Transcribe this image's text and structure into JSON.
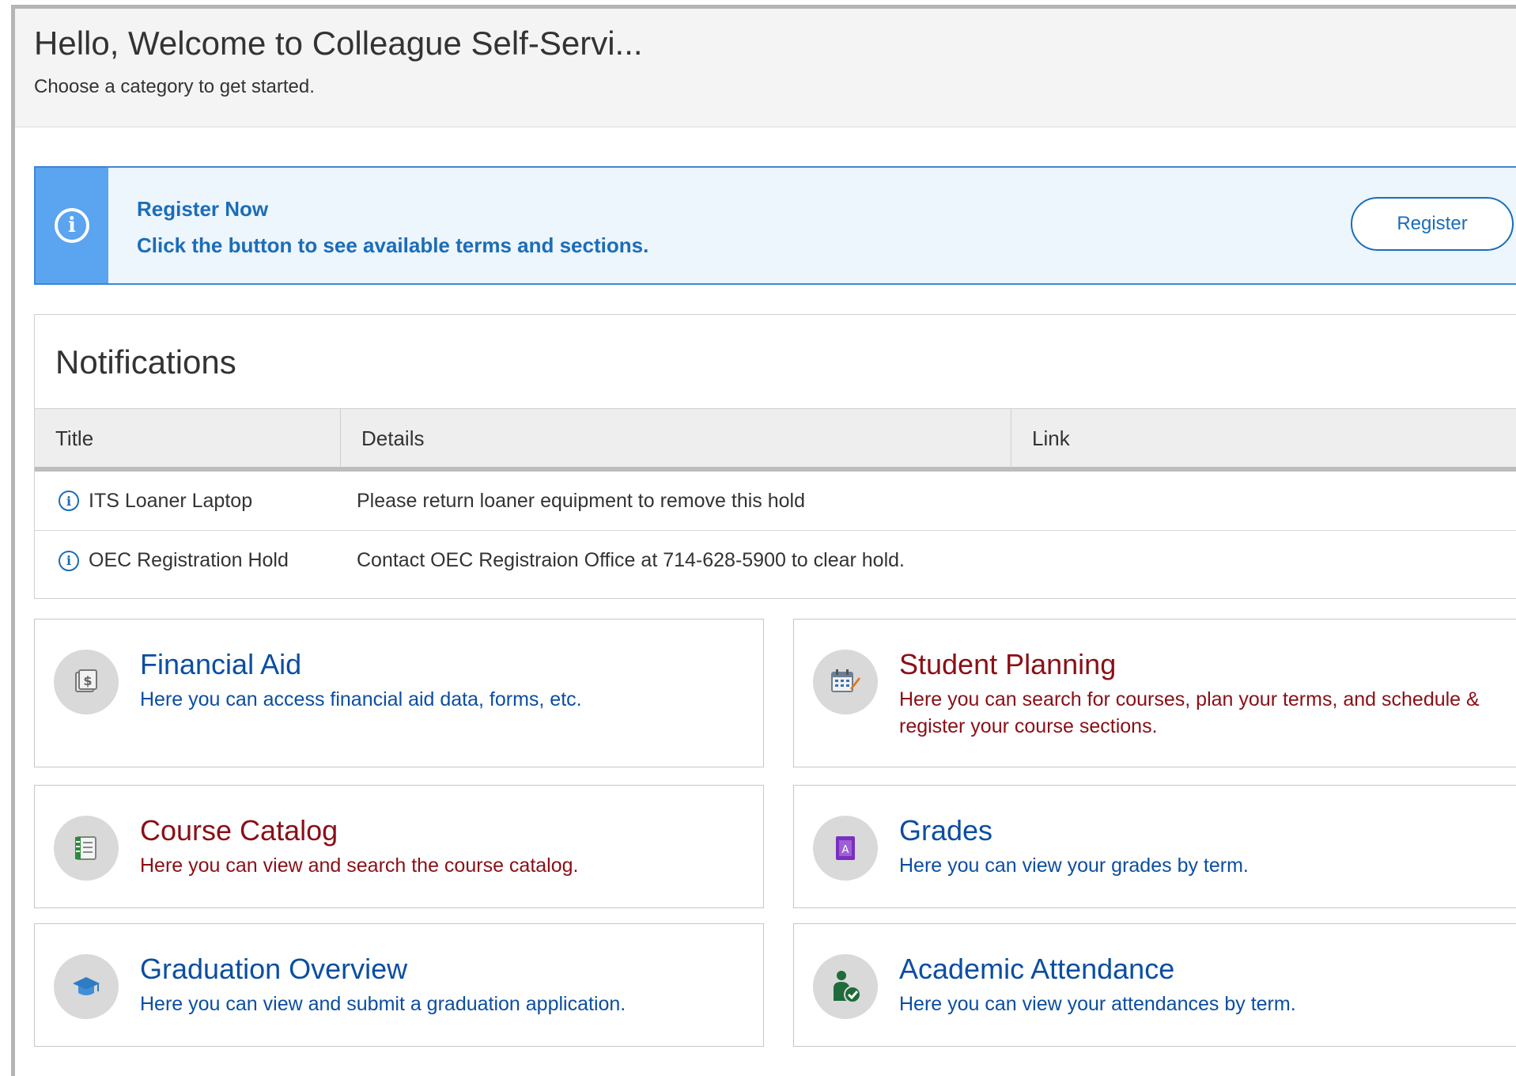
{
  "header": {
    "title": "Hello, Welcome to Colleague Self-Servi...",
    "subtitle": "Choose a category to get started."
  },
  "banner": {
    "icon": "info-icon",
    "title": "Register Now",
    "text": "Click the button to see available terms and sections.",
    "button_label": "Register",
    "colors": {
      "stripe": "#5aa4f0",
      "background": "#edf5fd",
      "text": "#1b6db8"
    }
  },
  "notifications": {
    "heading": "Notifications",
    "columns": [
      "Title",
      "Details",
      "Link"
    ],
    "rows": [
      {
        "icon": "info-icon",
        "title": "ITS Loaner Laptop",
        "details": "Please return loaner equipment to remove this hold",
        "link": ""
      },
      {
        "icon": "info-icon",
        "title": "OEC Registration Hold",
        "details": "Contact OEC Registraion Office at 714-628-5900 to clear hold.",
        "link": ""
      }
    ]
  },
  "tiles": [
    {
      "icon": "money-icon",
      "title": "Financial Aid",
      "description": "Here you can access financial aid data, forms, etc.",
      "color": "#0b4ea2"
    },
    {
      "icon": "calendar-edit-icon",
      "title": "Student Planning",
      "description": "Here you can search for courses, plan your terms, and schedule & register your course sections.",
      "color": "#8a0f16"
    },
    {
      "icon": "catalog-book-icon",
      "title": "Course Catalog",
      "description": "Here you can view and search the course catalog.",
      "color": "#8a0f16"
    },
    {
      "icon": "grade-report-icon",
      "title": "Grades",
      "description": "Here you can view your grades by term.",
      "color": "#0b4ea2"
    },
    {
      "icon": "graduation-cap-icon",
      "title": "Graduation Overview",
      "description": "Here you can view and submit a graduation application.",
      "color": "#0b4ea2"
    },
    {
      "icon": "attendance-person-check-icon",
      "title": "Academic Attendance",
      "description": "Here you can view your attendances by term.",
      "color": "#0b4ea2"
    }
  ]
}
